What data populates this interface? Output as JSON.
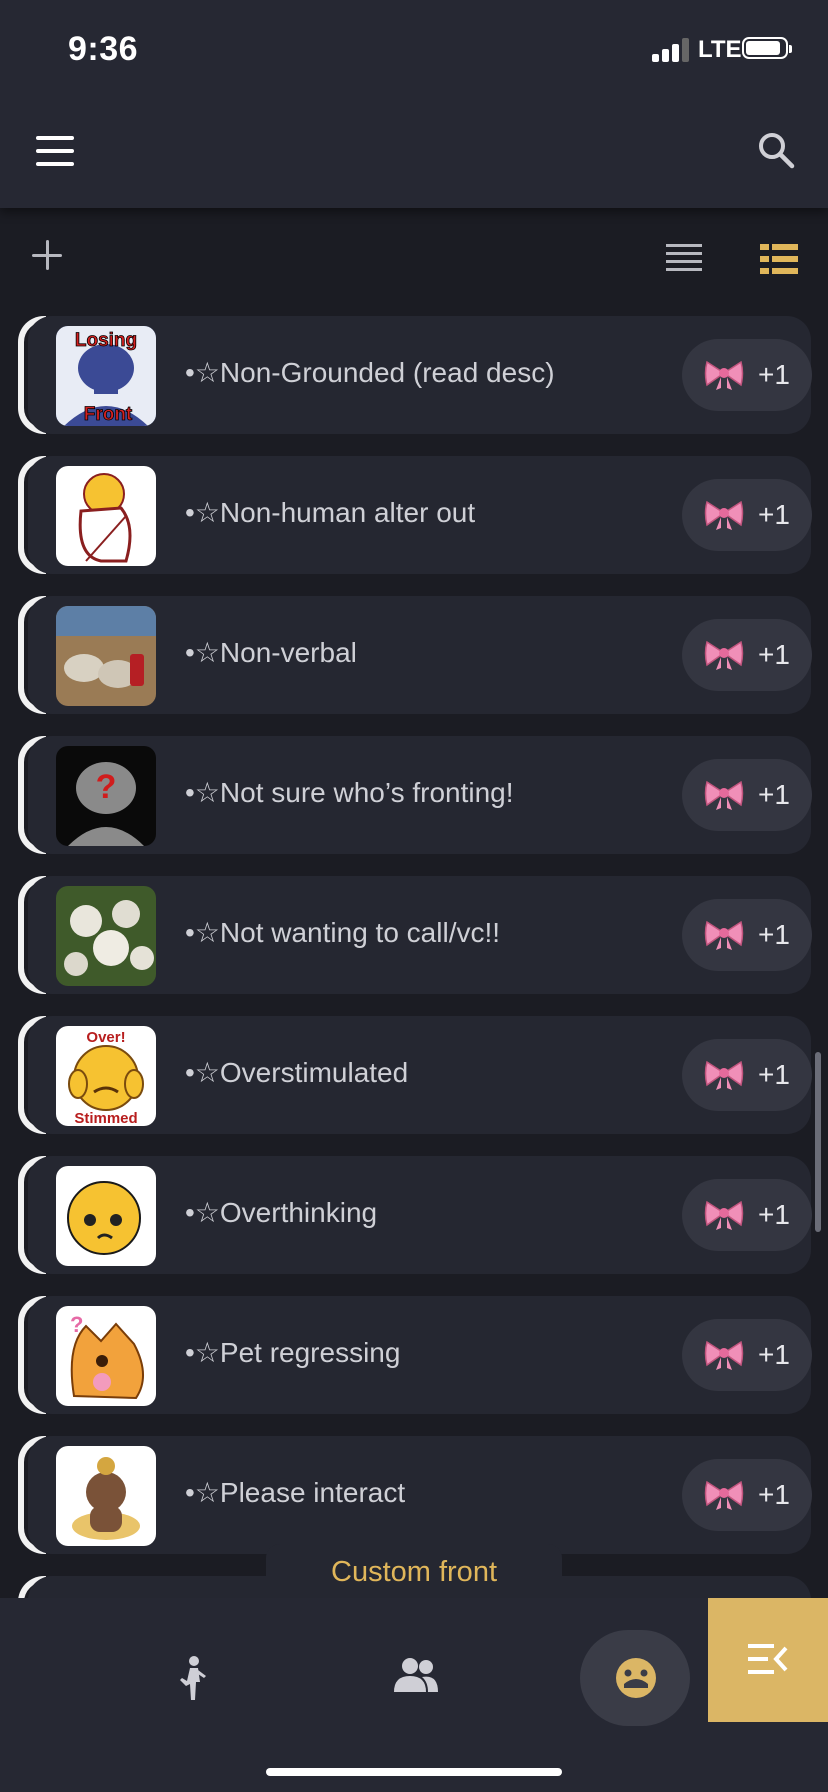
{
  "status_bar": {
    "time": "9:36",
    "network": "LTE"
  },
  "toolbar": {
    "add_icon": "plus-icon",
    "list_view_icon": "list-view-icon",
    "detail_view_icon": "detail-view-icon"
  },
  "rows": [
    {
      "label": "•☆Non-Grounded (read desc)",
      "avatar_text_top": "Losing",
      "avatar_text_bottom": "Front",
      "count": "+1"
    },
    {
      "label": "•☆Non-human alter out",
      "count": "+1"
    },
    {
      "label": "•☆Non-verbal",
      "count": "+1"
    },
    {
      "label": "•☆Not sure who’s fronting!",
      "count": "+1"
    },
    {
      "label": "•☆Not wanting to call/vc!!",
      "count": "+1"
    },
    {
      "label": "•☆Overstimulated",
      "avatar_text_top": "Over!",
      "avatar_text_bottom": "Stimmed",
      "count": "+1"
    },
    {
      "label": "•☆Overthinking",
      "count": "+1"
    },
    {
      "label": "•☆Pet regressing",
      "count": "+1"
    },
    {
      "label": "•☆Please interact",
      "count": "+1"
    }
  ],
  "custom_front_label": "Custom front",
  "colors": {
    "accent": "#dbb665",
    "background": "#1b1c23",
    "card": "#252731",
    "bow": "#f08fb8"
  }
}
